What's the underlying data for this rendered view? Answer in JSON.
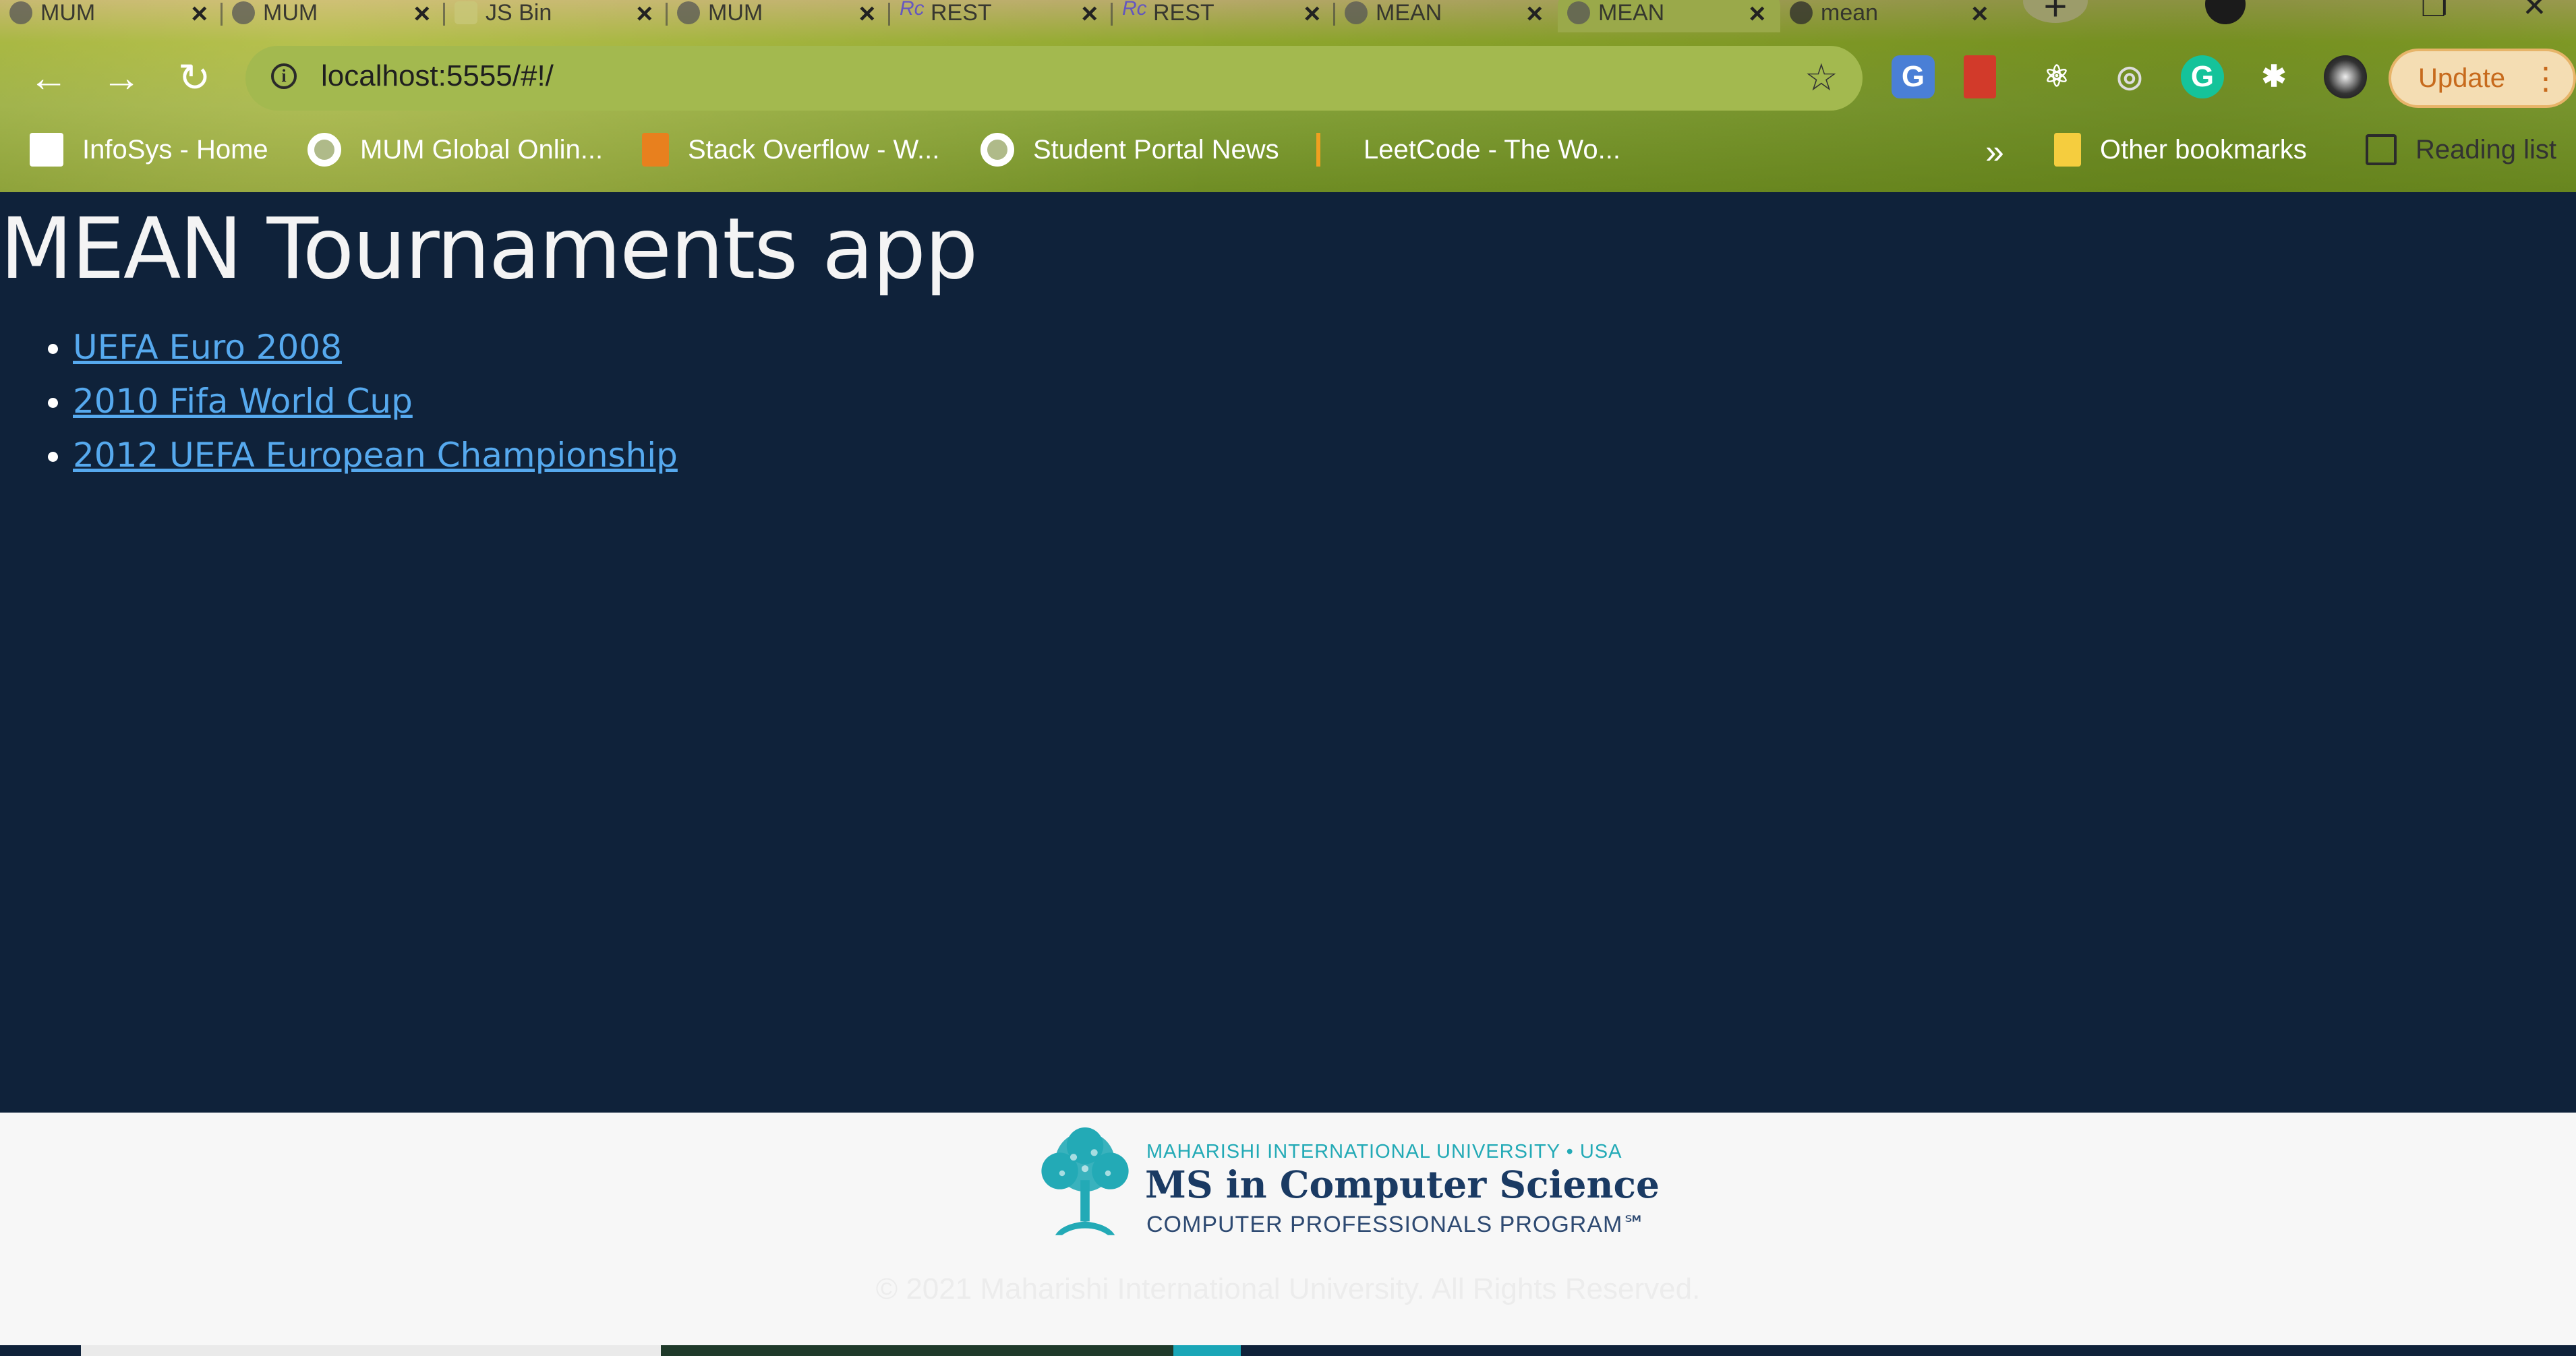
{
  "browser": {
    "tabs": [
      {
        "label": "MUM"
      },
      {
        "label": "MUM"
      },
      {
        "label": "JS Bin"
      },
      {
        "label": "MUM"
      },
      {
        "label": "REST"
      },
      {
        "label": "REST"
      },
      {
        "label": "MEAN"
      },
      {
        "label": "MEAN"
      },
      {
        "label": "mean"
      }
    ],
    "new_tab_symbol": "+",
    "url": "localhost:5555/#!/",
    "update_label": "Update",
    "menu_symbol": "⋮",
    "extensions": [
      {
        "icon": "google-translate-icon",
        "glyph": "G",
        "color": "#4a7fd6"
      },
      {
        "icon": "pdf-reader-icon",
        "glyph": "",
        "color": "#d23a2a"
      },
      {
        "icon": "react-devtools-icon",
        "glyph": "⚛",
        "color": "transparent"
      },
      {
        "icon": "circle-extension-icon",
        "glyph": "◎",
        "color": "transparent"
      },
      {
        "icon": "grammarly-icon",
        "glyph": "G",
        "color": "#15c39a"
      },
      {
        "icon": "extensions-puzzle-icon",
        "glyph": "✱",
        "color": "transparent"
      }
    ],
    "bookmarks": [
      {
        "label": "InfoSys - Home",
        "icon": "infosys-icon"
      },
      {
        "label": "MUM Global Onlin...",
        "icon": "globe-icon"
      },
      {
        "label": "Stack Overflow - W...",
        "icon": "stackoverflow-icon"
      },
      {
        "label": "Student Portal News",
        "icon": "globe-icon"
      },
      {
        "label": "LeetCode - The Wo...",
        "icon": "leetcode-icon"
      }
    ],
    "bookmarks_overflow": "»",
    "other_bookmarks": "Other bookmarks",
    "reading_list": "Reading list"
  },
  "page": {
    "title": "MEAN Tournaments app",
    "tournaments": [
      "UEFA Euro 2008",
      "2010 Fifa World Cup",
      "2012 UEFA European Championship"
    ],
    "link_color": "#56a9ee",
    "background": "#0f223a"
  },
  "footer": {
    "university": "MAHARISHI INTERNATIONAL UNIVERSITY • USA",
    "program": "MS in Computer Science",
    "program_sub": "COMPUTER PROFESSIONALS PROGRAM℠",
    "copyright": "© 2021 Maharishi International University. All Rights Reserved.",
    "brand_color": "#23aab6"
  }
}
